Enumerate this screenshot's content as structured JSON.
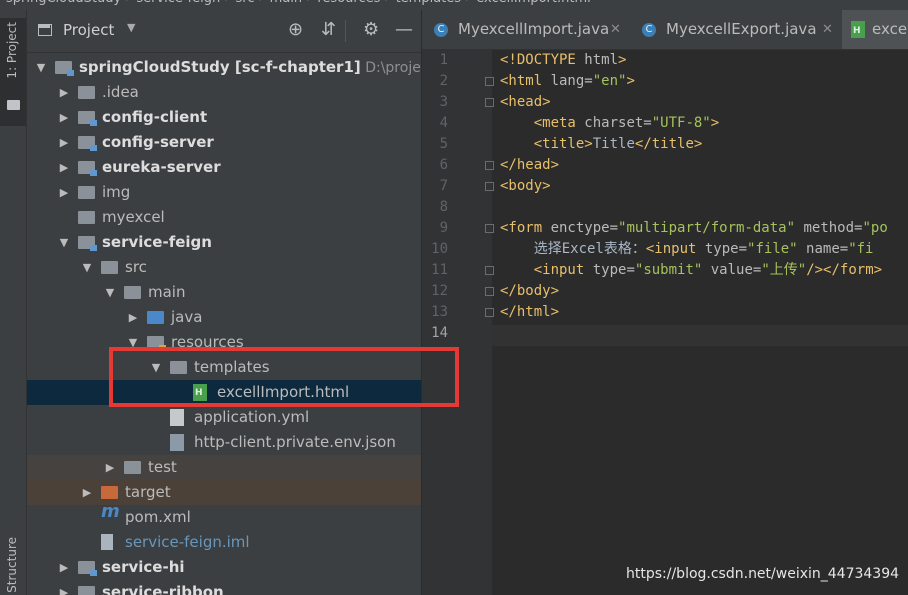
{
  "breadcrumb": [
    "springCloudStudy",
    "service-feign",
    "src",
    "main",
    "resources",
    "templates",
    "excellImport.html"
  ],
  "stripe": {
    "project_tab": "1: Project",
    "structure_tab": "Structure"
  },
  "panel": {
    "title": "Project"
  },
  "tree": [
    {
      "label": "springCloudStudy",
      "suffix": "[sc-f-chapter1]",
      "path": "D:\\projects\\",
      "indent": 0,
      "arrow": "down",
      "icon": "module-folder",
      "style": "root"
    },
    {
      "label": ".idea",
      "indent": 1,
      "arrow": "right",
      "icon": "folder"
    },
    {
      "label": "config-client",
      "indent": 1,
      "arrow": "right",
      "icon": "module-folder",
      "style": "bold"
    },
    {
      "label": "config-server",
      "indent": 1,
      "arrow": "right",
      "icon": "module-folder",
      "style": "bold"
    },
    {
      "label": "eureka-server",
      "indent": 1,
      "arrow": "right",
      "icon": "module-folder",
      "style": "bold"
    },
    {
      "label": "img",
      "indent": 1,
      "arrow": "right",
      "icon": "folder"
    },
    {
      "label": "myexcel",
      "indent": 1,
      "arrow": "",
      "icon": "folder"
    },
    {
      "label": "service-feign",
      "indent": 1,
      "arrow": "down",
      "icon": "module-folder",
      "style": "bold"
    },
    {
      "label": "src",
      "indent": 2,
      "arrow": "down",
      "icon": "folder"
    },
    {
      "label": "main",
      "indent": 3,
      "arrow": "down",
      "icon": "folder"
    },
    {
      "label": "java",
      "indent": 4,
      "arrow": "right",
      "icon": "source-folder"
    },
    {
      "label": "resources",
      "indent": 4,
      "arrow": "down",
      "icon": "resources-folder"
    },
    {
      "label": "templates",
      "indent": 5,
      "arrow": "down",
      "icon": "folder"
    },
    {
      "label": "excellImport.html",
      "indent": 6,
      "arrow": "",
      "icon": "html-file",
      "style": "selected"
    },
    {
      "label": "application.yml",
      "indent": 5,
      "arrow": "",
      "icon": "yml-file"
    },
    {
      "label": "http-client.private.env.json",
      "indent": 5,
      "arrow": "",
      "icon": "json-file"
    },
    {
      "label": "test",
      "indent": 3,
      "arrow": "right",
      "icon": "folder"
    },
    {
      "label": "target",
      "indent": 2,
      "arrow": "right",
      "icon": "excluded-folder",
      "style": "orange"
    },
    {
      "label": "pom.xml",
      "indent": 2,
      "arrow": "",
      "icon": "maven-icon"
    },
    {
      "label": "service-feign.iml",
      "indent": 2,
      "arrow": "",
      "icon": "iml-file",
      "style": "blue"
    },
    {
      "label": "service-hi",
      "indent": 1,
      "arrow": "right",
      "icon": "module-folder",
      "style": "bold"
    },
    {
      "label": "service-ribbon",
      "indent": 1,
      "arrow": "right",
      "icon": "module-folder",
      "style": "bold"
    }
  ],
  "tabs": [
    {
      "label": "MyexcellImport.java",
      "icon": "class-icon"
    },
    {
      "label": "MyexcellExport.java",
      "icon": "class-icon"
    },
    {
      "label": "exce",
      "icon": "html-icon",
      "active": true
    }
  ],
  "editor": {
    "line_numbers": [
      "1",
      "2",
      "3",
      "4",
      "5",
      "6",
      "7",
      "8",
      "9",
      "10",
      "11",
      "12",
      "13",
      "14"
    ],
    "current_line": "14",
    "lines": [
      [
        [
          "tag",
          "<!DOCTYPE "
        ],
        [
          "attr",
          "html"
        ],
        [
          "tag",
          ">"
        ]
      ],
      [
        [
          "tag",
          "<html "
        ],
        [
          "attr",
          "lang="
        ],
        [
          "val",
          "\"en\""
        ],
        [
          "tag",
          ">"
        ]
      ],
      [
        [
          "tag",
          "<head>"
        ]
      ],
      [
        [
          "txt",
          "    "
        ],
        [
          "tag",
          "<meta "
        ],
        [
          "attr",
          "charset="
        ],
        [
          "val",
          "\"UTF-8\""
        ],
        [
          "tag",
          ">"
        ]
      ],
      [
        [
          "txt",
          "    "
        ],
        [
          "tag",
          "<title>"
        ],
        [
          "txt",
          "Title"
        ],
        [
          "tag",
          "</title>"
        ]
      ],
      [
        [
          "tag",
          "</head>"
        ]
      ],
      [
        [
          "tag",
          "<body>"
        ]
      ],
      [
        [
          "txt",
          ""
        ]
      ],
      [
        [
          "tag",
          "<form "
        ],
        [
          "attr",
          "enctype="
        ],
        [
          "val",
          "\"multipart/form-data\""
        ],
        [
          "attr",
          " method="
        ],
        [
          "val",
          "\"po"
        ]
      ],
      [
        [
          "txt",
          "    选择Excel表格："
        ],
        [
          "tag",
          "<input "
        ],
        [
          "attr",
          "type="
        ],
        [
          "val",
          "\"file\""
        ],
        [
          "attr",
          " name="
        ],
        [
          "val",
          "\"fi"
        ]
      ],
      [
        [
          "txt",
          "    "
        ],
        [
          "tag",
          "<input "
        ],
        [
          "attr",
          "type="
        ],
        [
          "val",
          "\"submit\""
        ],
        [
          "attr",
          " value="
        ],
        [
          "val",
          "\"上传\""
        ],
        [
          "tag",
          "/></form>"
        ]
      ],
      [
        [
          "tag",
          "</body>"
        ]
      ],
      [
        [
          "tag",
          "</html>"
        ]
      ],
      [
        [
          "txt",
          ""
        ]
      ]
    ]
  },
  "watermark": "https://blog.csdn.net/weixin_44734394"
}
